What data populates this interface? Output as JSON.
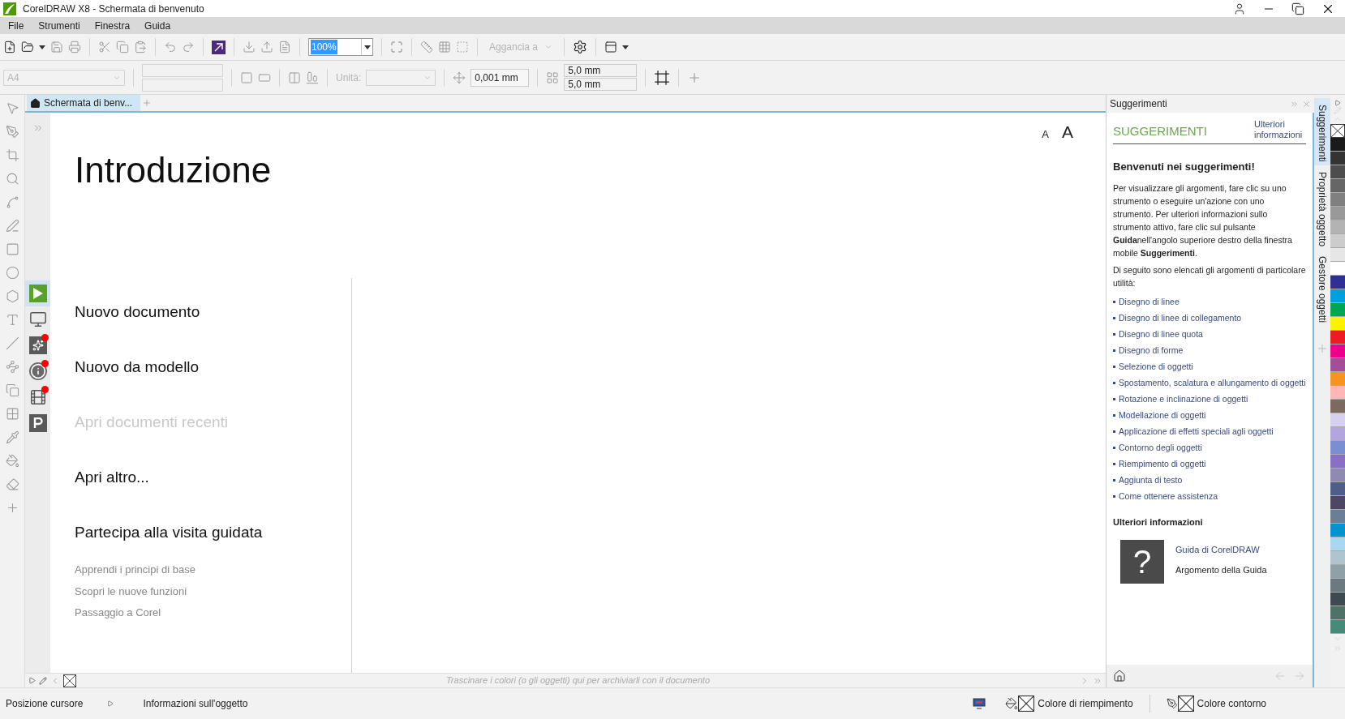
{
  "window": {
    "title": "CorelDRAW X8 - Schermata di benvenuto"
  },
  "menu": [
    "File",
    "Strumenti",
    "Finestra",
    "Guida"
  ],
  "standard_toolbar": {
    "zoom": "100%",
    "snap": "Aggancia a"
  },
  "property_bar": {
    "page_size": "A4",
    "units_label": "Unità:",
    "nudge": "0,001 mm",
    "duplicate_x": "5,0 mm",
    "duplicate_y": "5,0 mm"
  },
  "document_tabs": [
    {
      "label": "Schermata di benv...",
      "selected": true
    }
  ],
  "welcome": {
    "font_sizes": [
      "A",
      "A"
    ],
    "heading": "Introduzione",
    "side_tabs": [
      {
        "selected": true,
        "badge": false
      },
      {
        "selected": false,
        "badge": false
      },
      {
        "selected": false,
        "badge": true
      },
      {
        "selected": false,
        "badge": true
      },
      {
        "selected": false,
        "badge": true
      },
      {
        "selected": false,
        "badge": false
      }
    ],
    "items": [
      {
        "label": "Nuovo documento",
        "disabled": false
      },
      {
        "label": "Nuovo da modello",
        "disabled": false
      },
      {
        "label": "Apri documenti recenti",
        "disabled": true
      },
      {
        "label": "Apri altro...",
        "disabled": false
      },
      {
        "label": "Partecipa alla visita guidata",
        "disabled": false
      }
    ],
    "links": [
      "Apprendi i principi di base",
      "Scopri le nuove funzioni",
      "Passaggio a Corel"
    ]
  },
  "document_palette": {
    "hint": "Trascinare i colori (o gli oggetti) qui per archiviarli con il documento"
  },
  "docker": {
    "title": "Suggerimenti",
    "header": "SUGGERIMENTI",
    "more_link": "Ulteriori informazioni",
    "heading": "Benvenuti nei suggerimenti!",
    "paragraphs": [
      "Per visualizzare gli argomenti, fare clic su uno strumento o eseguire un'azione con uno strumento. Per ulteriori informazioni sullo strumento attivo, fare clic sul pulsante **Guida**nell'angolo superiore destro della finestra mobile **Suggerimenti**.",
      "Di seguito sono elencati gli argomenti di particolare utilità:"
    ],
    "topics": [
      "Disegno di linee",
      "Disegno di linee di collegamento",
      "Disegno di linee quota",
      "Disegno di forme",
      "Selezione di oggetti",
      "Spostamento, scalatura e allungamento di oggetti",
      "Rotazione e inclinazione di oggetti",
      "Modellazione di oggetti",
      "Applicazione di effetti speciali agli oggetti",
      "Contorno degli oggetti",
      "Riempimento di oggetti",
      "Aggiunta di testo",
      "Come ottenere assistenza"
    ],
    "more_heading": "Ulteriori informazioni",
    "help_icon": "?",
    "help_links": [
      {
        "label": "Guida di CorelDRAW",
        "kind": "link"
      },
      {
        "label": "Argomento della Guida",
        "kind": "text"
      }
    ]
  },
  "docker_tabs": [
    {
      "label": "Suggerimenti",
      "selected": true
    },
    {
      "label": "Proprietà oggetto",
      "selected": false
    },
    {
      "label": "Gestore oggetti",
      "selected": false
    }
  ],
  "palette": [
    {
      "color": "#1a1a1a"
    },
    {
      "color": "#333333"
    },
    {
      "color": "#4d4d4d"
    },
    {
      "color": "#666666"
    },
    {
      "color": "#808080"
    },
    {
      "color": "#999999"
    },
    {
      "color": "#b3b3b3"
    },
    {
      "color": "#cccccc"
    },
    {
      "color": "#e6e6e6"
    },
    {
      "color": "#ffffff"
    },
    {
      "color": "#2e3192"
    },
    {
      "color": "#00a0dc"
    },
    {
      "color": "#00a651"
    },
    {
      "color": "#fff200"
    },
    {
      "color": "#ed1c24"
    },
    {
      "color": "#ec008c"
    },
    {
      "color": "#a54c9b"
    },
    {
      "color": "#f7941d"
    },
    {
      "color": "#ffb6b6"
    },
    {
      "color": "#7c6a5f"
    },
    {
      "color": "#d7d0ee"
    },
    {
      "color": "#b3a6e0"
    },
    {
      "color": "#7a8fd1"
    },
    {
      "color": "#8a6fc7"
    },
    {
      "color": "#8f8ab3"
    },
    {
      "color": "#4f5d8a"
    },
    {
      "color": "#4c4763"
    },
    {
      "color": "#6a7f96"
    },
    {
      "color": "#0093d0"
    },
    {
      "color": "#a8d8f0"
    },
    {
      "color": "#b0c4d0"
    },
    {
      "color": "#8fa0a8"
    },
    {
      "color": "#6b7a80"
    },
    {
      "color": "#3d4a4f"
    },
    {
      "color": "#4e7268"
    },
    {
      "color": "#468a7a"
    }
  ],
  "status_bar": {
    "cursor": "Posizione cursore",
    "object_info": "Informazioni sull'oggetto",
    "fill": "Colore di riempimento",
    "outline": "Colore contorno"
  }
}
